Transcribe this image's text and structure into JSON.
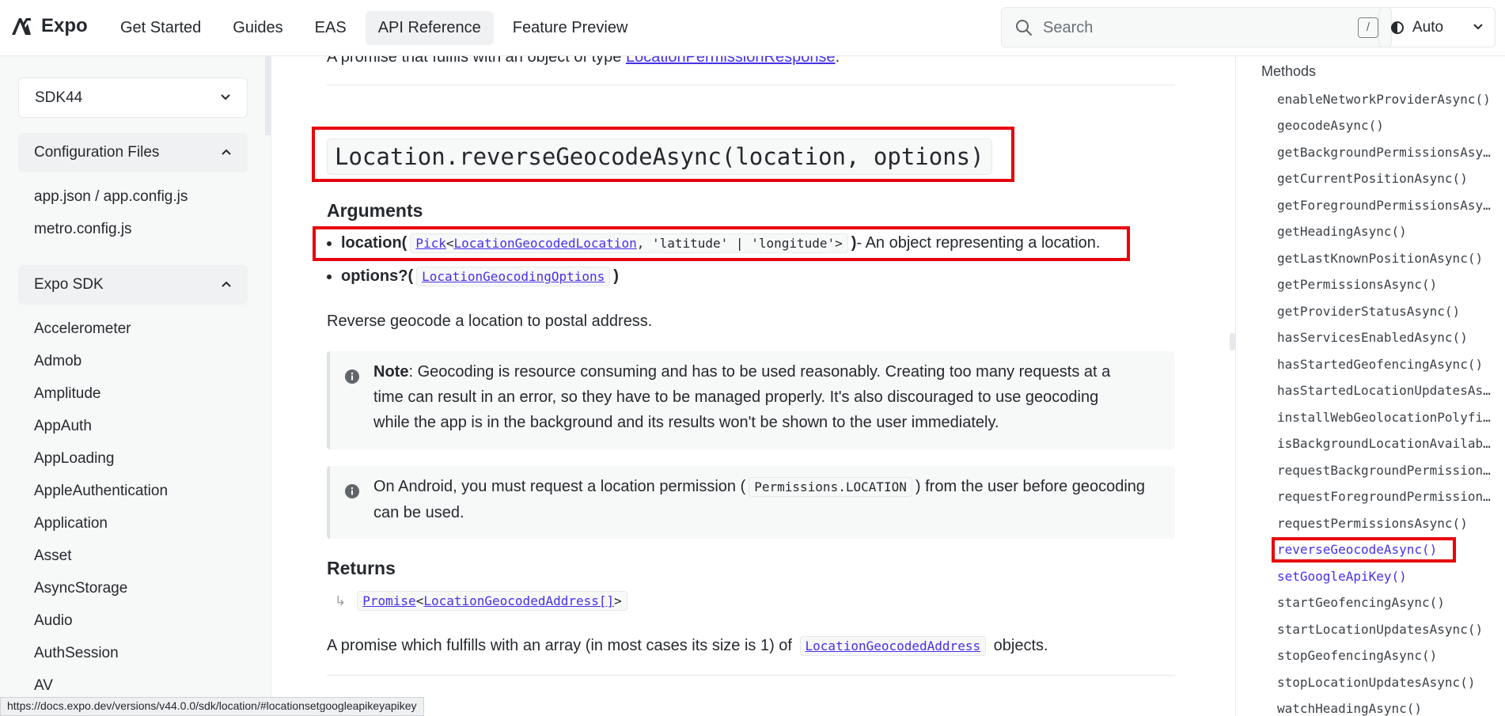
{
  "header": {
    "brand": "Expo",
    "nav": [
      {
        "label": "Get Started"
      },
      {
        "label": "Guides"
      },
      {
        "label": "EAS"
      },
      {
        "label": "API Reference"
      },
      {
        "label": "Feature Preview"
      }
    ],
    "search_placeholder": "Search",
    "search_shortcut": "/",
    "theme_label": "Auto"
  },
  "sidebar": {
    "sdk_version": "SDK44",
    "sections": [
      {
        "label": "Configuration Files",
        "items": [
          "app.json / app.config.js",
          "metro.config.js"
        ]
      },
      {
        "label": "Expo SDK",
        "items": [
          "Accelerometer",
          "Admob",
          "Amplitude",
          "AppAuth",
          "AppLoading",
          "AppleAuthentication",
          "Application",
          "Asset",
          "AsyncStorage",
          "Audio",
          "AuthSession",
          "AV"
        ]
      }
    ]
  },
  "main": {
    "prev_return_prefix": "A promise that fulfils with an object of type ",
    "prev_return_link": "LocationPermissionResponse",
    "prev_return_suffix": ".",
    "method_signature": "Location.reverseGeocodeAsync(location, options)",
    "arguments_heading": "Arguments",
    "arg1": {
      "name": "location",
      "open": " (",
      "type_pick": "Pick",
      "type_link": "LocationGeocodedLocation",
      "type_rest": ", 'latitude' | 'longitude'>",
      "close": ")",
      "description": " - An object representing a location."
    },
    "arg2": {
      "name": "options?",
      "open": " (",
      "type_link": "LocationGeocodingOptions",
      "close": ")"
    },
    "description": "Reverse geocode a location to postal address.",
    "note": {
      "label": "Note",
      "line1": ": Geocoding is resource consuming and has to be used reasonably. Creating too many requests at a",
      "line2": "time can result in an error, so they have to be managed properly. It's also discouraged to use geocoding",
      "line3": "while the app is in the background and its results won't be shown to the user immediately."
    },
    "android_note": {
      "prefix": "On Android, you must request a location permission (",
      "code": "Permissions.LOCATION",
      "suffix": ") from the user before geocoding",
      "line2": "can be used."
    },
    "returns_heading": "Returns",
    "returns_type_promise": "Promise",
    "returns_type_link": "LocationGeocodedAddress[]",
    "returns_description_prefix": "A promise which fulfills with an array (in most cases its size is 1) of ",
    "returns_description_code": "LocationGeocodedAddress",
    "returns_description_suffix": " objects."
  },
  "toc": {
    "title": "Methods",
    "items": [
      "enableNetworkProviderAsync()",
      "geocodeAsync()",
      "getBackgroundPermissionsAsync()",
      "getCurrentPositionAsync()",
      "getForegroundPermissionsAsync()",
      "getHeadingAsync()",
      "getLastKnownPositionAsync()",
      "getPermissionsAsync()",
      "getProviderStatusAsync()",
      "hasServicesEnabledAsync()",
      "hasStartedGeofencingAsync()",
      "hasStartedLocationUpdatesAsync()",
      "installWebGeolocationPolyfill()",
      "isBackgroundLocationAvailableAsync()",
      "requestBackgroundPermissionsAsync()",
      "requestForegroundPermissionsAsync()",
      "requestPermissionsAsync()",
      "reverseGeocodeAsync()",
      "setGoogleApiKey()",
      "startGeofencingAsync()",
      "startLocationUpdatesAsync()",
      "stopGeofencingAsync()",
      "stopLocationUpdatesAsync()",
      "watchHeadingAsync()"
    ]
  },
  "status_url": "https://docs.expo.dev/versions/v44.0.0/sdk/location/#locationsetgoogleapikeyapikey",
  "colors": {
    "link": "#4630eb",
    "highlight": "#e8000c"
  }
}
